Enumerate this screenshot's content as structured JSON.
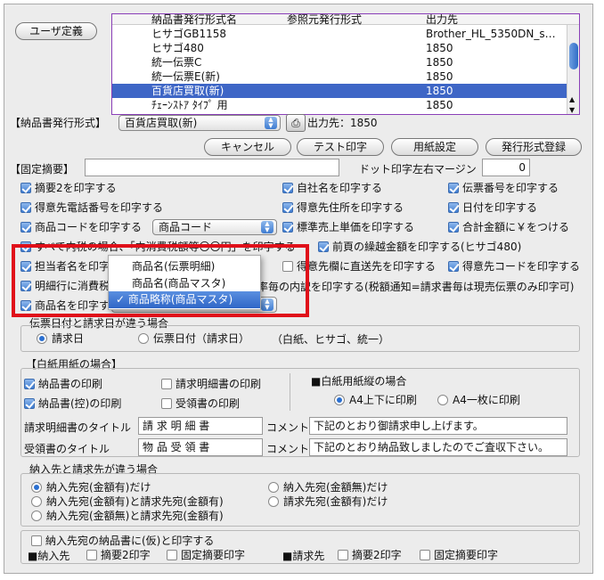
{
  "top": {
    "user_def_button": "ユーザ定義",
    "columns": [
      "納品書発行形式名",
      "参照元発行形式",
      "出力先"
    ],
    "rows": [
      [
        "ヒサゴGB1158",
        "",
        "Brother_HL_5350DN_s…"
      ],
      [
        "ヒサゴ480",
        "",
        "1850"
      ],
      [
        "統一伝票C",
        "",
        "1850"
      ],
      [
        "統一伝票E(新)",
        "",
        "1850"
      ],
      [
        "百貨店買取(新)",
        "",
        "1850"
      ],
      [
        "ﾁｪｰﾝｽﾄｱ ﾀｲﾌﾟ 用",
        "",
        "1850"
      ]
    ],
    "selected_row": 4
  },
  "format_bar": {
    "label": "【納品書発行形式】",
    "value": "百貨店買取(新)",
    "output": "出力先：1850"
  },
  "buttons": {
    "cancel": "キャンセル",
    "test_print": "テスト印字",
    "paper": "用紙設定",
    "register": "発行形式登録"
  },
  "fixed": {
    "label": "【固定摘要】",
    "margin_label": "ドット印字左右マージン",
    "margin_value": "0"
  },
  "opts": {
    "tekiyo2": "摘要2を印字する",
    "jisha": "自社名を印字する",
    "denpyo": "伝票番号を印字する",
    "tel": "得意先電話番号を印字する",
    "addr": "得意先住所を印字する",
    "date": "日付を印字する",
    "code": "商品コードを印字する",
    "code_sel": "商品コード",
    "tanka": "標準売上単価を印字する",
    "yen": "合計金額に￥をつける",
    "tax_msg": "すべて内税の場合、「内消費税額等〇〇円」を印字する",
    "kurikoshi": "前頁の繰越金額を印字する(ヒサゴ480)",
    "tanto": "担当者名を印字",
    "chokuso": "得意先欄に直送先を印字する",
    "tokucode": "得意先コードを印字する",
    "meisai": "明細行に消費税",
    "uchiwake": "税率毎の内訳を印字する(税額通知=請求書毎は現売伝票のみ印字可)",
    "shohin": "商品名を印字す"
  },
  "menu": {
    "items": [
      "商品名(伝票明細)",
      "商品名(商品マスタ)",
      "商品略称(商品マスタ)"
    ],
    "checked": 2
  },
  "date_sec": {
    "title": "伝票日付と請求日が違う場合",
    "opt1": "請求日",
    "opt2": "伝票日付（請求日）",
    "note": "（白紙、ヒサゴ、統一）"
  },
  "hakushi": {
    "title": "【白紙用紙の場合】",
    "nohin": "納品書の印刷",
    "seikyu_meisai": "請求明細書の印刷",
    "hikae": "納品書(控)の印刷",
    "juryo": "受領書の印刷",
    "tate": "■白紙用紙縦の場合",
    "a4_2": "A4上下に印刷",
    "a4_1": "A4一枚に印刷",
    "seikyu_title_label": "請求明細書のタイトル",
    "seikyu_title": "請 求 明 細 書",
    "comment_label": "コメント",
    "comment1": "下記のとおり御請求申し上げます。",
    "juryo_title_label": "受領書のタイトル",
    "juryo_title": "物 品 受 領 書",
    "comment2": "下記のとおり納品致しましたのでご査収下さい。"
  },
  "nonyu": {
    "title": "納入先と請求先が違う場合",
    "r1": "納入先宛(金額有)だけ",
    "r2": "納入先宛(金額有)と請求先宛(金額有)",
    "r3": "納入先宛(金額無)と請求先宛(金額有)",
    "r4": "納入先宛(金額無)だけ",
    "r5": "請求先宛(金額有)だけ",
    "kari": "納入先宛の納品書に(仮)と印字する",
    "nonyu_label": "■納入先",
    "tekiyo2": "摘要2印字",
    "kotei": "固定摘要印字",
    "seikyu_label": "■請求先"
  }
}
